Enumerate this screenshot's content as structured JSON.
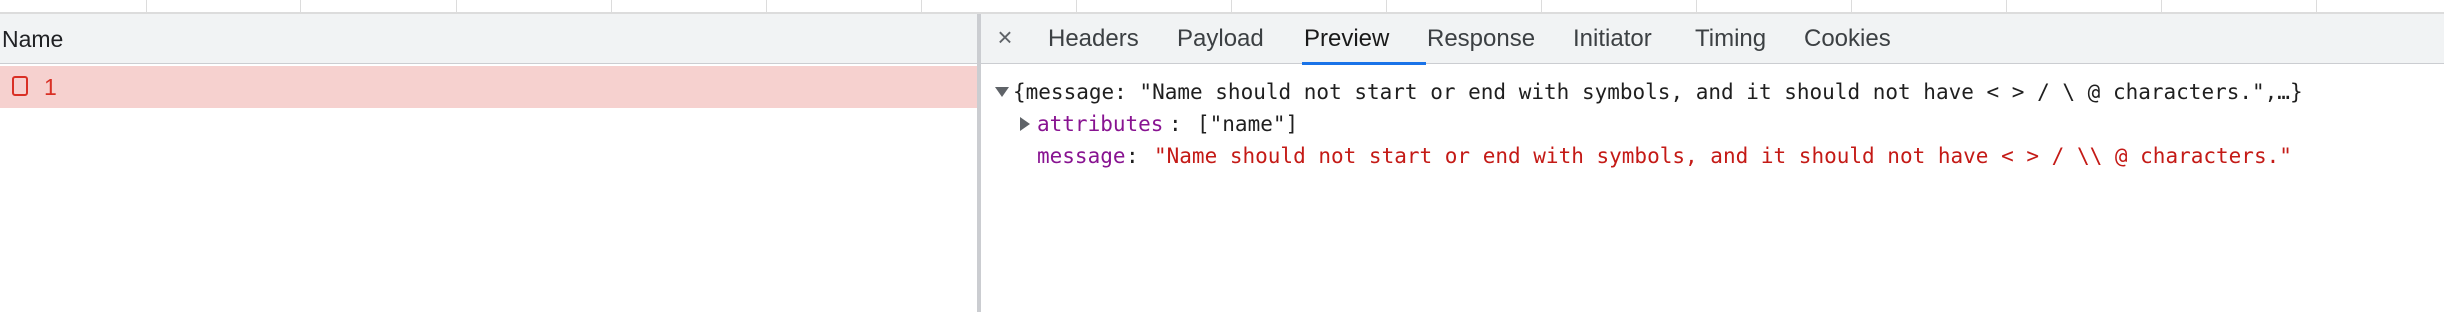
{
  "requests_panel": {
    "header_label": "Name",
    "rows": [
      {
        "name": "1",
        "status": "error"
      }
    ]
  },
  "details_panel": {
    "close_label": "×",
    "tabs": [
      {
        "label": "Headers",
        "active": false
      },
      {
        "label": "Payload",
        "active": false
      },
      {
        "label": "Preview",
        "active": true
      },
      {
        "label": "Response",
        "active": false
      },
      {
        "label": "Initiator",
        "active": false
      },
      {
        "label": "Timing",
        "active": false
      },
      {
        "label": "Cookies",
        "active": false
      }
    ],
    "preview": {
      "summary": "{message: \"Name should not start or end with symbols, and it should not have < > / \\ @ characters.\",…}",
      "attributes_key": "attributes",
      "attributes_value": "[\"name\"]",
      "message_key": "message",
      "message_value": "\"Name should not start or end with symbols, and it should not have < > / \\\\ @ characters.\""
    }
  },
  "colors": {
    "error_row_bg": "#f6d1cf",
    "error_text": "#d93025",
    "active_tab_underline": "#1a73e8",
    "json_key": "#881391",
    "json_string": "#c41a16"
  },
  "icons": {
    "request_row_icon": "document-icon",
    "close": "close-icon",
    "expanded": "triangle-down-icon",
    "collapsed": "triangle-right-icon"
  }
}
